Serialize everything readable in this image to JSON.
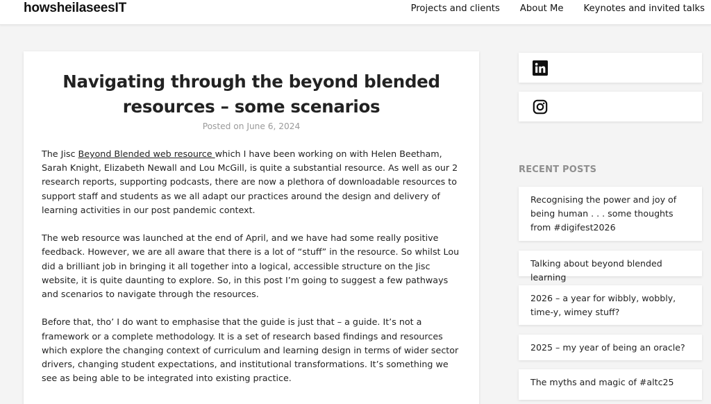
{
  "site": {
    "title": "howsheilaseesIT"
  },
  "nav": {
    "items": [
      {
        "label": "Projects and clients"
      },
      {
        "label": "About Me"
      },
      {
        "label": "Keynotes and invited talks"
      }
    ]
  },
  "post": {
    "title": "Navigating through the beyond blended resources – some scenarios",
    "meta": "Posted on June 6, 2024",
    "p1_before_link": "The Jisc ",
    "p1_link": "Beyond Blended web resource ",
    "p1_after_link": "which I have been working on with Helen Beetham, Sarah Knight, Elizabeth Newall and Lou McGill, is quite a substantial resource. As well as our 2 research reports, supporting podcasts, there are now a plethora of downloadable resources to support staff and students as we all adapt our practices around the design and delivery of learning activities in our post pandemic context.",
    "p2": "The web resource was launched at the end of April, and we have had some really positive feedback. However, we are all aware that there is a lot of “stuff” in the resource. So whilst Lou did a brilliant job in bringing it all together into a logical, accessible structure on the Jisc website, it is quite daunting to explore. So, in this post I’m going to suggest a few pathways and scenarios to navigate through the resources.",
    "p3": "Before that, tho’ I do want to emphasise that the guide is just that – a guide. It’s not a framework or a complete methodology. It is a set of research based findings and resources which explore the changing context of curriculum and learning design in terms of wider sector drivers, changing student expectations, and institutional transformations. It’s something we see as being able to be integrated into existing practice."
  },
  "sidebar": {
    "social": [
      {
        "icon": "linkedin-icon"
      },
      {
        "icon": "instagram-icon"
      }
    ],
    "recent_heading": "RECENT POSTS",
    "recent_posts": [
      {
        "label": "Recognising the power and joy of being human . . . some thoughts from #digifest2026"
      },
      {
        "label": "Talking about beyond blended learning"
      },
      {
        "label": "2026 – a year for wibbly, wobbly, time-y, wimey stuff?"
      },
      {
        "label": "2025 – my year of being an oracle?"
      },
      {
        "label": "The myths and magic of #altc25"
      }
    ]
  },
  "colors": {
    "background": "#f4f4f4",
    "card": "#ffffff",
    "text": "#222222",
    "muted": "#9a9a9a"
  }
}
